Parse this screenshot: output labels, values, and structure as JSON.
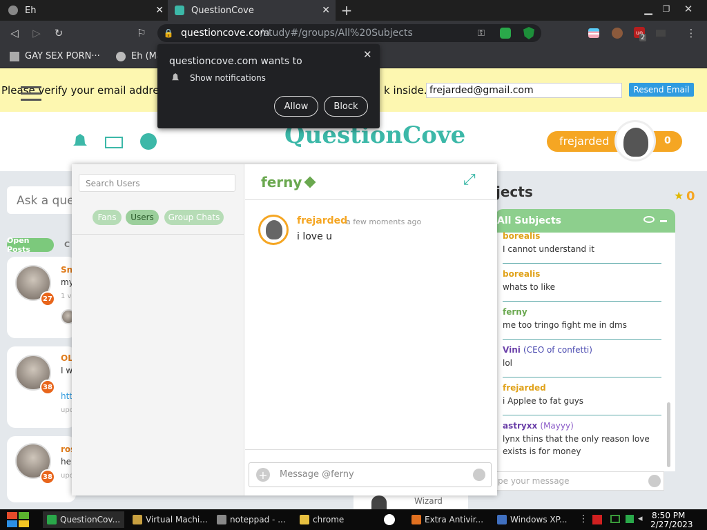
{
  "browser": {
    "tabs": [
      {
        "title": "Eh",
        "active": false
      },
      {
        "title": "QuestionCove",
        "active": true
      }
    ],
    "url_domain": "questioncove.com",
    "url_path": "/study#/groups/All%20Subjects",
    "bookmarks": [
      "GAY SEX PORN···",
      "Eh (Ma"
    ],
    "badge_count": "2"
  },
  "notification": {
    "title": "questioncove.com wants to",
    "item": "Show notifications",
    "allow": "Allow",
    "block": "Block"
  },
  "verify_banner": {
    "text_left": "Please verify your email address.",
    "text_right": "k inside.",
    "email": "frejarded@gmail.com",
    "resend": "Resend Email"
  },
  "header": {
    "logo": "QuestionCove",
    "username": "frejarded",
    "points": "0"
  },
  "left_feed": {
    "ask_placeholder": "Ask a ques",
    "tab_open": "Open Posts",
    "tab_other": "C",
    "posts": [
      {
        "name": "Sn",
        "text": "my",
        "meta": "1 v",
        "badge": "27"
      },
      {
        "name": "OL",
        "text": "I w",
        "link": "htt",
        "meta": "upc",
        "badge": "38"
      },
      {
        "name": "ros",
        "text": "hel",
        "meta": "upc",
        "badge": "38"
      }
    ],
    "bottom_label": "Wizard"
  },
  "chat": {
    "search_placeholder": "Search Users",
    "pills": [
      "Fans",
      "Users",
      "Group Chats"
    ],
    "recipient": "ferny",
    "messages": [
      {
        "user": "frejarded",
        "time": "a few moments ago",
        "text": "i love u"
      }
    ],
    "input_placeholder": "Message @ferny"
  },
  "subjects": {
    "heading": "jects",
    "star_count": "0",
    "panel_title": "All Subjects",
    "messages": [
      {
        "user": "borealis",
        "tag": "",
        "text": "I cannot understand it",
        "color": "#e0a21a"
      },
      {
        "user": "borealis",
        "tag": "",
        "text": "whats to like",
        "color": "#e0a21a"
      },
      {
        "user": "ferny",
        "tag": "",
        "text": "me too tringo fight me in dms",
        "color": "#6aa84f"
      },
      {
        "user": "Vini",
        "tag": "(CEO of confetti)",
        "text": "lol",
        "color": "#6a3fa8"
      },
      {
        "user": "frejarded",
        "tag": "",
        "text": "i Applee to fat guys",
        "color": "#e0a21a"
      },
      {
        "user": "astryxx",
        "tag": "(Mayyy)",
        "text": "lynx thins that the only reason love exists is for money",
        "color": "#6a3fa8"
      }
    ],
    "input_placeholder": "pe your message"
  },
  "taskbar": {
    "items": [
      "QuestionCov...",
      "Virtual Machi...",
      "noteppad - ...",
      "chrome",
      "Extra Antivir...",
      "Windows XP..."
    ],
    "time": "8:50 PM",
    "date": "2/27/2023"
  }
}
